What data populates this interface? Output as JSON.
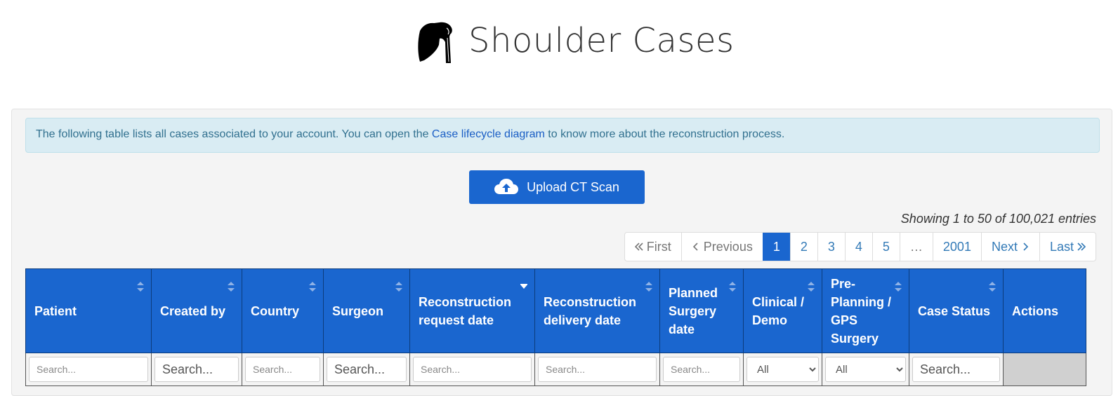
{
  "header": {
    "title": "Shoulder Cases",
    "logo_icon": "shoulder-bone-icon"
  },
  "info": {
    "text_before": "The following table lists all cases associated to your account. You can open the ",
    "link": "Case lifecycle diagram",
    "text_after": " to know more about the reconstruction process."
  },
  "upload": {
    "label": "Upload CT Scan",
    "icon": "cloud-upload-icon"
  },
  "showing": "Showing 1 to 50 of 100,021 entries",
  "pagination": {
    "first": "First",
    "previous": "Previous",
    "pages": [
      "1",
      "2",
      "3",
      "4",
      "5"
    ],
    "ellipsis": "…",
    "last_page": "2001",
    "next": "Next",
    "last": "Last",
    "active_page": "1"
  },
  "table": {
    "columns": [
      "Patient",
      "Created by",
      "Country",
      "Surgeon",
      "Reconstruction request date",
      "Reconstruction delivery date",
      "Planned Surgery date",
      "Clinical / Demo",
      "Pre-Planning / GPS Surgery",
      "Case Status",
      "Actions"
    ],
    "filters": {
      "search_placeholder": "Search...",
      "clinical_selected": "All",
      "preplanning_selected": "All"
    }
  },
  "colors": {
    "primary": "#1a66cf",
    "info_bg": "#d9ecf3",
    "info_text": "#31708f",
    "link": "#1a5ec5"
  }
}
